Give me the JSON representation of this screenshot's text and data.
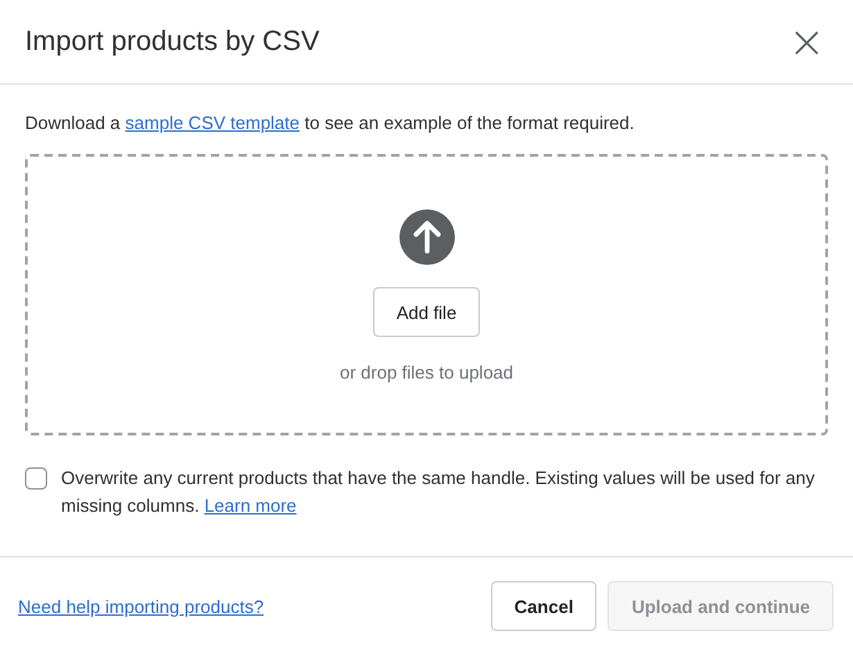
{
  "dialog": {
    "title": "Import products by CSV",
    "close": "×"
  },
  "intro": {
    "before": "Download a ",
    "link": "sample CSV template",
    "after": " to see an example of the format required."
  },
  "dropzone": {
    "button": "Add file",
    "hint": "or drop files to upload"
  },
  "overwrite": {
    "checked": false,
    "text": "Overwrite any current products that have the same handle. Existing values will be used for any missing columns. ",
    "link": "Learn more"
  },
  "footer": {
    "help_link": "Need help importing products?",
    "buttons": [
      {
        "label": "Cancel",
        "kind": "secondary",
        "disabled": false
      },
      {
        "label": "Upload and continue",
        "kind": "primary",
        "disabled": true
      }
    ]
  }
}
